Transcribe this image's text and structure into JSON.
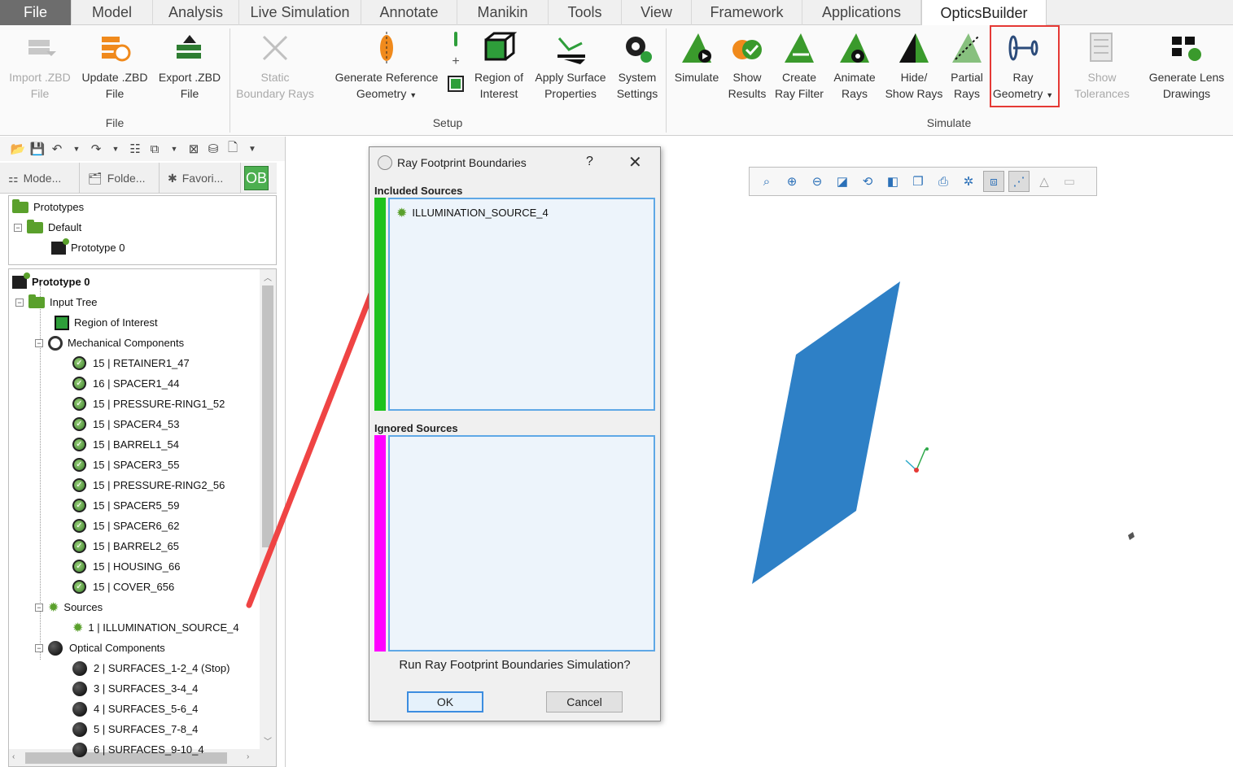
{
  "menu_tabs": [
    "File",
    "Model",
    "Analysis",
    "Live Simulation",
    "Annotate",
    "Manikin",
    "Tools",
    "View",
    "Framework",
    "Applications",
    "OpticsBuilder"
  ],
  "ribbon": {
    "file_group": {
      "label": "File",
      "buttons": [
        {
          "line1": "Import .ZBD",
          "line2": "File",
          "disabled": true,
          "icon": "import-icon"
        },
        {
          "line1": "Update .ZBD",
          "line2": "File",
          "disabled": false,
          "icon": "update-icon"
        },
        {
          "line1": "Export .ZBD",
          "line2": "File",
          "disabled": false,
          "icon": "export-icon"
        }
      ]
    },
    "setup_group": {
      "label": "Setup",
      "buttons": [
        {
          "line1": "Static",
          "line2": "Boundary Rays",
          "disabled": true,
          "icon": "static-rays-icon"
        },
        {
          "line1": "Generate Reference",
          "line2": "Geometry",
          "disabled": false,
          "icon": "reference-geometry-icon"
        },
        {
          "line1": "Region of",
          "line2": "Interest",
          "disabled": false,
          "icon": "region-icon"
        },
        {
          "line1": "Apply Surface",
          "line2": "Properties",
          "disabled": false,
          "icon": "surface-icon"
        },
        {
          "line1": "System",
          "line2": "Settings",
          "disabled": false,
          "icon": "gear-icon"
        }
      ]
    },
    "simulate_group": {
      "label": "Simulate",
      "buttons": [
        {
          "line1": "Simulate",
          "line2": "",
          "icon": "simulate-icon"
        },
        {
          "line1": "Show",
          "line2": "Results",
          "icon": "results-icon"
        },
        {
          "line1": "Create",
          "line2": "Ray Filter",
          "icon": "ray-filter-icon"
        },
        {
          "line1": "Animate",
          "line2": "Rays",
          "icon": "animate-icon"
        },
        {
          "line1": "Hide/",
          "line2": "Show Rays",
          "icon": "hide-show-icon"
        },
        {
          "line1": "Partial",
          "line2": "Rays",
          "icon": "partial-rays-icon"
        },
        {
          "line1": "Ray",
          "line2": "Geometry",
          "icon": "ray-geometry-icon"
        }
      ]
    },
    "other_buttons": [
      {
        "line1": "Show",
        "line2": "Tolerances",
        "disabled": true,
        "icon": "tolerances-icon"
      },
      {
        "line1": "Generate Lens",
        "line2": "Drawings",
        "disabled": false,
        "icon": "lens-drawings-icon"
      }
    ]
  },
  "panel_tabs": [
    {
      "label": "Mode...",
      "icon": "model-icon"
    },
    {
      "label": "Folde...",
      "icon": "folder-icon"
    },
    {
      "label": "Favori...",
      "icon": "favorites-icon"
    },
    {
      "label": "OB",
      "icon": "ob-icon"
    }
  ],
  "prototypes_tree": {
    "root": "Prototypes",
    "default": "Default",
    "prototype": "Prototype 0"
  },
  "model_tree": {
    "root": "Prototype 0",
    "input_tree": "Input Tree",
    "region": "Region of Interest",
    "mechanical": "Mechanical Components",
    "mechanical_items": [
      "15 |  RETAINER1_47",
      "16 |  SPACER1_44",
      "15 |  PRESSURE-RING1_52",
      "15 |  SPACER4_53",
      "15 |  BARREL1_54",
      "15 |  SPACER3_55",
      "15 |  PRESSURE-RING2_56",
      "15 |  SPACER5_59",
      "15 |  SPACER6_62",
      "15 |  BARREL2_65",
      "15 |  HOUSING_66",
      "15 |  COVER_656"
    ],
    "sources": "Sources",
    "source_items": [
      "1 |  ILLUMINATION_SOURCE_4"
    ],
    "optical": "Optical Components",
    "optical_items": [
      "2 |  SURFACES_1-2_4  (Stop)",
      "3 |  SURFACES_3-4_4",
      "4 |  SURFACES_5-6_4",
      "5 |  SURFACES_7-8_4",
      "6 |  SURFACES_9-10_4"
    ]
  },
  "dialog": {
    "title": "Ray Footprint Boundaries",
    "help": "?",
    "close": "✕",
    "included_label": "Included Sources",
    "included_items": [
      "ILLUMINATION_SOURCE_4"
    ],
    "ignored_label": "Ignored Sources",
    "ignored_items": [],
    "question": "Run Ray Footprint Boundaries Simulation?",
    "ok_label": "OK",
    "cancel_label": "Cancel",
    "included_color": "#1ec21e",
    "ignored_color": "#ff00ff"
  },
  "colors": {
    "accent": "#2b70b8",
    "highlight_box": "#e53935",
    "shape": "#2e80c6",
    "arrow": "#ef4444"
  }
}
